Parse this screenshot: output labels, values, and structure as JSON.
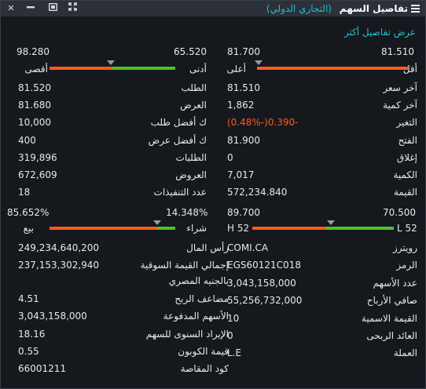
{
  "window": {
    "title": "تفاصيل السهم",
    "subtitle": "(التجاري الدولي)",
    "more_link": "عرض تفاصيل أكثر",
    "controls": [
      "close-icon",
      "minimize-icon",
      "restore-icon",
      "expand-icon"
    ]
  },
  "colors": {
    "accent": "#1fc0c9",
    "negative": "#ff5a1f",
    "positive": "#4fc12b",
    "background": "#15181d",
    "titlebar": "#2c3139"
  },
  "range_right": {
    "low_value": "81.510",
    "high_value": "81.700",
    "low_label": "أقل",
    "high_label": "أعلى",
    "fill_fraction": 0.0
  },
  "range_left": {
    "low_value": "65.520",
    "high_value": "98.280",
    "low_label": "أدنى",
    "high_label": "أقصى",
    "orange_fraction": 0.5
  },
  "right_rows": [
    {
      "label": "آخر سعر",
      "value": "81.510"
    },
    {
      "label": "آخر كمية",
      "value": "1,862"
    },
    {
      "label": "التغير",
      "value": "(0.48%-)0.390-"
    },
    {
      "label": "الفتح",
      "value": "81.900"
    },
    {
      "label": "إغلاق",
      "value": "0"
    },
    {
      "label": "الكمية",
      "value": "7,017"
    },
    {
      "label": "القيمة",
      "value": "572,234.840"
    }
  ],
  "left_rows": [
    {
      "label": "الطلب",
      "value": "81.520"
    },
    {
      "label": "العرض",
      "value": "81.680"
    },
    {
      "label": "ك أفضل طلب",
      "value": "10,000"
    },
    {
      "label": "ك أفضل عرض",
      "value": "400"
    },
    {
      "label": "الطلبات",
      "value": "319,896"
    },
    {
      "label": "العروض",
      "value": "672,609"
    },
    {
      "label": "عدد التنفيذات",
      "value": "18"
    }
  ],
  "hl_bar": {
    "h_value": "89.700",
    "l_value": "70.500",
    "h_label": "H 52",
    "l_label": "L 52",
    "orange_fraction": 0.52
  },
  "buysell_bar": {
    "buy_pct": "14.348%",
    "sell_pct": "85.652%",
    "buy_label": "شراء",
    "sell_label": "بيع",
    "green_fraction": 0.14348
  },
  "bottom_right_rows": [
    {
      "label": "رويترز",
      "value": "COMI.CA"
    },
    {
      "label": "الرمز",
      "value": "EGS60121C018"
    },
    {
      "label": "عدد الأسهم",
      "value": "3,043,158,000"
    },
    {
      "label": "صافي الأرباح",
      "value": "55,256,732,000"
    },
    {
      "label": "القيمة الاسمية",
      "value": "10"
    },
    {
      "label": "العائد الربحى",
      "value": "0"
    },
    {
      "label": "العملة",
      "value": "L.E"
    }
  ],
  "bottom_left_rows": [
    {
      "label": "رأس المال",
      "value": "249,234,640,200"
    },
    {
      "label": "إجمالي القيمة السوقية",
      "value": "237,153,302,940"
    },
    {
      "label": "بالجنيه المصري",
      "value": ""
    },
    {
      "label": "مضاعف الربح",
      "value": "4.51"
    },
    {
      "label": "الأسهم المدفوعة",
      "value": "3,043,158,000"
    },
    {
      "label": "الإيراد السنوى للسهم",
      "value": "18.16"
    },
    {
      "label": "قيمة الكوبون",
      "value": "0.55"
    },
    {
      "label": "كود المقاصة",
      "value": "66001211"
    }
  ]
}
